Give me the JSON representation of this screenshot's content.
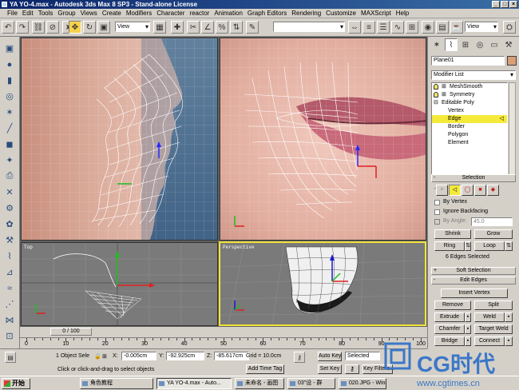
{
  "window": {
    "title": "YA YO-4.max - Autodesk 3ds Max 8 SP3 - Stand-alone License"
  },
  "menu": [
    "File",
    "Edit",
    "Tools",
    "Group",
    "Views",
    "Create",
    "Modifiers",
    "Character",
    "reactor",
    "Animation",
    "Graph Editors",
    "Rendering",
    "Customize",
    "MAXScript",
    "Help"
  ],
  "toolbar": {
    "coord_system": "View",
    "selection_set": "",
    "ref_coord_right": "View"
  },
  "viewports": {
    "top_label": "Top",
    "persp_label": "Perspective",
    "axes": {
      "x": "x",
      "y": "y",
      "z": "z"
    }
  },
  "panel": {
    "object_name": "Plane01",
    "modifier_list": "Modifier List",
    "stack": [
      {
        "label": "MeshSmooth"
      },
      {
        "label": "Symmetry"
      },
      {
        "label": "Editable Poly"
      },
      {
        "label": "Vertex"
      },
      {
        "label": "Edge"
      },
      {
        "label": "Border"
      },
      {
        "label": "Polygon"
      },
      {
        "label": "Element"
      }
    ],
    "selection": {
      "title": "Selection",
      "by_vertex": "By Vertex",
      "ignore_backfacing": "Ignore Backfacing",
      "by_angle": "By Angle:",
      "angle_value": "45.0",
      "shrink": "Shrink",
      "grow": "Grow",
      "ring": "Ring",
      "loop": "Loop",
      "status": "6 Edges Selected"
    },
    "soft_selection": "Soft Selection",
    "edit_edges": {
      "title": "Edit Edges",
      "insert_vertex": "Insert Vertex",
      "remove": "Remove",
      "split": "Split",
      "extrude": "Extrude",
      "weld": "Weld",
      "chamfer": "Chamfer",
      "target_weld": "Target Weld",
      "bridge": "Bridge",
      "connect": "Connect"
    }
  },
  "timeline": {
    "frame": "0 / 100",
    "ticks": [
      "0",
      "10",
      "20",
      "30",
      "40",
      "50",
      "60",
      "70",
      "80",
      "90",
      "100"
    ]
  },
  "status": {
    "selected": "1 Object Sele",
    "x_label": "X:",
    "x": "-0.005cm",
    "y_label": "Y:",
    "y": "-92.925cm",
    "z_label": "Z:",
    "z": "-85.617cm",
    "grid": "Grid = 10.0cm",
    "prompt": "Click or click-and-drag to select objects",
    "add_time_tag": "Add Time Tag",
    "auto_key": "Auto Key",
    "auto_key_value": "Selected",
    "set_key": "Set Key",
    "key_filters": "Key Filters..."
  },
  "taskbar": {
    "start": "开始",
    "tasks": [
      "角色教程",
      "YA YO-4.max - Auto...",
      "未命名 - 画图",
      "03\"设 - 群",
      "020.JPG - Windows ..."
    ]
  },
  "watermark": {
    "brand": "CG时代",
    "url": "www.cgtimes.cn"
  }
}
